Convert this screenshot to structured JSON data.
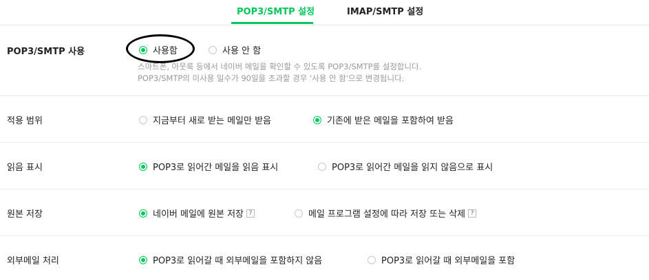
{
  "tabs": [
    {
      "label": "POP3/SMTP 설정",
      "active": true
    },
    {
      "label": "IMAP/SMTP 설정",
      "active": false
    }
  ],
  "accent_color": "#03c75a",
  "rows": [
    {
      "label": "POP3/SMTP 사용",
      "options": [
        {
          "label": "사용함",
          "selected": true
        },
        {
          "label": "사용 안 함",
          "selected": false
        }
      ],
      "description": [
        "스마트폰, 아웃룩 등에서 네이버 메일을 확인할 수 있도록 POP3/SMTP를 설정합니다.",
        "POP3/SMTP의 미사용 일수가 90일을 초과할 경우 '사용 안 함'으로 변경됩니다."
      ]
    },
    {
      "label": "적용 범위",
      "options": [
        {
          "label": "지금부터 새로 받는 메일만 받음",
          "selected": false
        },
        {
          "label": "기존에 받은 메일을 포함하여 받음",
          "selected": true
        }
      ]
    },
    {
      "label": "읽음 표시",
      "options": [
        {
          "label": "POP3로 읽어간 메일을 읽음 표시",
          "selected": true
        },
        {
          "label": "POP3로 읽어간 메일을 읽지 않음으로 표시",
          "selected": false
        }
      ]
    },
    {
      "label": "원본 저장",
      "options": [
        {
          "label": "네이버 메일에 원본 저장",
          "selected": true,
          "help": "?"
        },
        {
          "label": "메일 프로그램 설정에 따라 저장 또는 삭제",
          "selected": false,
          "help": "?"
        }
      ]
    },
    {
      "label": "외부메일 처리",
      "options": [
        {
          "label": "POP3로 읽어갈 때 외부메일을 포함하지 않음",
          "selected": true
        },
        {
          "label": "POP3로 읽어갈 때 외부메일을 포함",
          "selected": false
        }
      ]
    }
  ]
}
